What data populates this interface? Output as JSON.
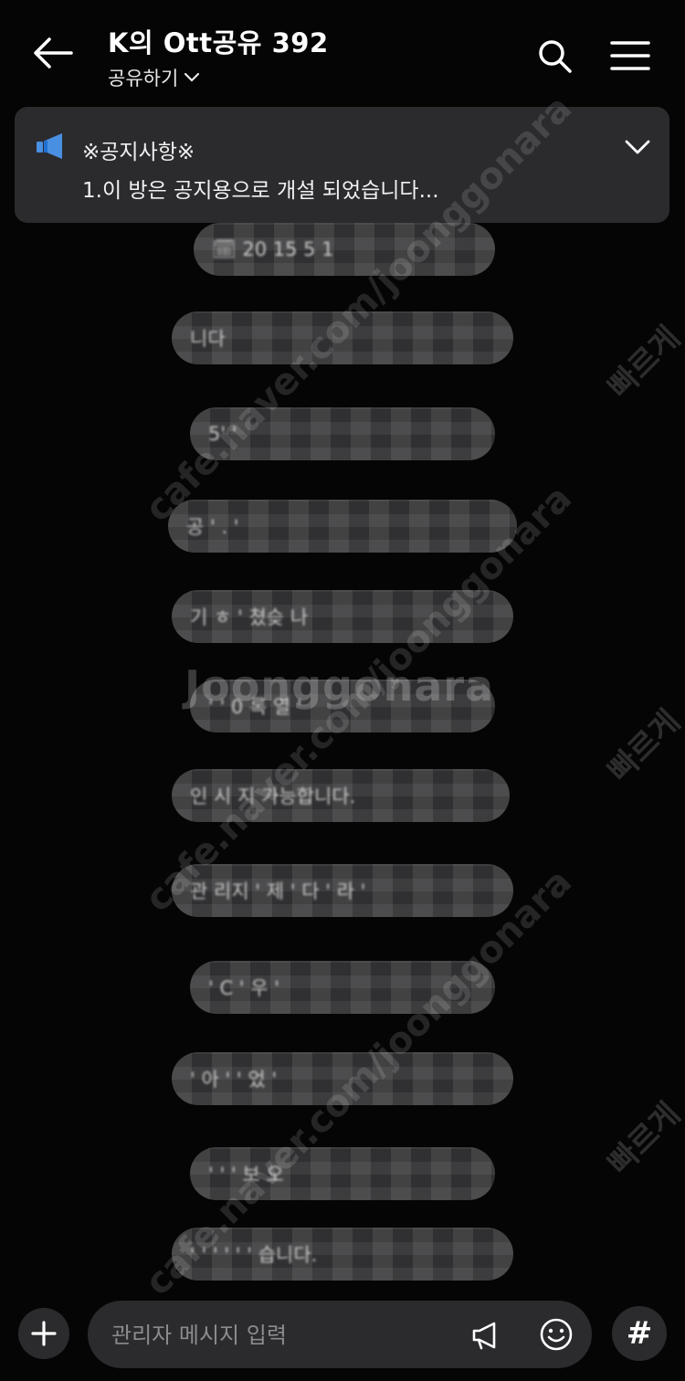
{
  "header": {
    "title": "K의 Ott공유 392",
    "subtitle": "공유하기"
  },
  "notice": {
    "title": "※공지사항※",
    "body": "1.이 방은 공지용으로 개설 되었습니다..."
  },
  "messages": [
    {
      "text": "🗓 20   15  5  1"
    },
    {
      "text": "           니다"
    },
    {
      "text": "      5'  '      "
    },
    {
      "text": "공 ' .          '  "
    },
    {
      "text": "    기   ㅎ   ' 쳤슺 나"
    },
    {
      "text": "   '     ' 0  록 열 '"
    },
    {
      "text": "          인 시  지  가능합니다."
    },
    {
      "text": "관 리지 ' 제   ' 다 ' 라 '  "
    },
    {
      "text": "  '  C    '   우 '  "
    },
    {
      "text": "      '  아 '    '  었 '  "
    },
    {
      "text": "  '  '       '  보 오"
    },
    {
      "text": "   '  '  '  '  '  '  습니다."
    }
  ],
  "watermarks": {
    "domain": "cafe.naver.com/joonggonara",
    "logo": "Joonggonara",
    "korean": "빠르게"
  },
  "bottom": {
    "input_placeholder": "관리자 메시지 입력",
    "hash_label": "#"
  },
  "colors": {
    "background": "#050505",
    "panel": "#2b2b2e",
    "accent_icon": "#4a90e2"
  }
}
